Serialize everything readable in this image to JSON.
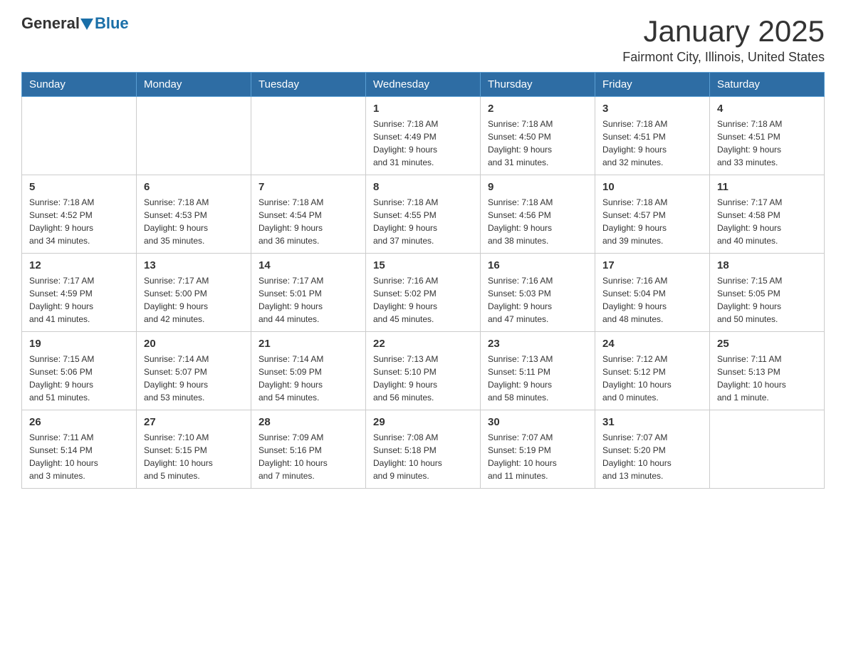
{
  "header": {
    "logo": {
      "general": "General",
      "blue": "Blue"
    },
    "title": "January 2025",
    "location": "Fairmont City, Illinois, United States"
  },
  "days_of_week": [
    "Sunday",
    "Monday",
    "Tuesday",
    "Wednesday",
    "Thursday",
    "Friday",
    "Saturday"
  ],
  "weeks": [
    {
      "cells": [
        {
          "day": "",
          "info": ""
        },
        {
          "day": "",
          "info": ""
        },
        {
          "day": "",
          "info": ""
        },
        {
          "day": "1",
          "info": "Sunrise: 7:18 AM\nSunset: 4:49 PM\nDaylight: 9 hours\nand 31 minutes."
        },
        {
          "day": "2",
          "info": "Sunrise: 7:18 AM\nSunset: 4:50 PM\nDaylight: 9 hours\nand 31 minutes."
        },
        {
          "day": "3",
          "info": "Sunrise: 7:18 AM\nSunset: 4:51 PM\nDaylight: 9 hours\nand 32 minutes."
        },
        {
          "day": "4",
          "info": "Sunrise: 7:18 AM\nSunset: 4:51 PM\nDaylight: 9 hours\nand 33 minutes."
        }
      ]
    },
    {
      "cells": [
        {
          "day": "5",
          "info": "Sunrise: 7:18 AM\nSunset: 4:52 PM\nDaylight: 9 hours\nand 34 minutes."
        },
        {
          "day": "6",
          "info": "Sunrise: 7:18 AM\nSunset: 4:53 PM\nDaylight: 9 hours\nand 35 minutes."
        },
        {
          "day": "7",
          "info": "Sunrise: 7:18 AM\nSunset: 4:54 PM\nDaylight: 9 hours\nand 36 minutes."
        },
        {
          "day": "8",
          "info": "Sunrise: 7:18 AM\nSunset: 4:55 PM\nDaylight: 9 hours\nand 37 minutes."
        },
        {
          "day": "9",
          "info": "Sunrise: 7:18 AM\nSunset: 4:56 PM\nDaylight: 9 hours\nand 38 minutes."
        },
        {
          "day": "10",
          "info": "Sunrise: 7:18 AM\nSunset: 4:57 PM\nDaylight: 9 hours\nand 39 minutes."
        },
        {
          "day": "11",
          "info": "Sunrise: 7:17 AM\nSunset: 4:58 PM\nDaylight: 9 hours\nand 40 minutes."
        }
      ]
    },
    {
      "cells": [
        {
          "day": "12",
          "info": "Sunrise: 7:17 AM\nSunset: 4:59 PM\nDaylight: 9 hours\nand 41 minutes."
        },
        {
          "day": "13",
          "info": "Sunrise: 7:17 AM\nSunset: 5:00 PM\nDaylight: 9 hours\nand 42 minutes."
        },
        {
          "day": "14",
          "info": "Sunrise: 7:17 AM\nSunset: 5:01 PM\nDaylight: 9 hours\nand 44 minutes."
        },
        {
          "day": "15",
          "info": "Sunrise: 7:16 AM\nSunset: 5:02 PM\nDaylight: 9 hours\nand 45 minutes."
        },
        {
          "day": "16",
          "info": "Sunrise: 7:16 AM\nSunset: 5:03 PM\nDaylight: 9 hours\nand 47 minutes."
        },
        {
          "day": "17",
          "info": "Sunrise: 7:16 AM\nSunset: 5:04 PM\nDaylight: 9 hours\nand 48 minutes."
        },
        {
          "day": "18",
          "info": "Sunrise: 7:15 AM\nSunset: 5:05 PM\nDaylight: 9 hours\nand 50 minutes."
        }
      ]
    },
    {
      "cells": [
        {
          "day": "19",
          "info": "Sunrise: 7:15 AM\nSunset: 5:06 PM\nDaylight: 9 hours\nand 51 minutes."
        },
        {
          "day": "20",
          "info": "Sunrise: 7:14 AM\nSunset: 5:07 PM\nDaylight: 9 hours\nand 53 minutes."
        },
        {
          "day": "21",
          "info": "Sunrise: 7:14 AM\nSunset: 5:09 PM\nDaylight: 9 hours\nand 54 minutes."
        },
        {
          "day": "22",
          "info": "Sunrise: 7:13 AM\nSunset: 5:10 PM\nDaylight: 9 hours\nand 56 minutes."
        },
        {
          "day": "23",
          "info": "Sunrise: 7:13 AM\nSunset: 5:11 PM\nDaylight: 9 hours\nand 58 minutes."
        },
        {
          "day": "24",
          "info": "Sunrise: 7:12 AM\nSunset: 5:12 PM\nDaylight: 10 hours\nand 0 minutes."
        },
        {
          "day": "25",
          "info": "Sunrise: 7:11 AM\nSunset: 5:13 PM\nDaylight: 10 hours\nand 1 minute."
        }
      ]
    },
    {
      "cells": [
        {
          "day": "26",
          "info": "Sunrise: 7:11 AM\nSunset: 5:14 PM\nDaylight: 10 hours\nand 3 minutes."
        },
        {
          "day": "27",
          "info": "Sunrise: 7:10 AM\nSunset: 5:15 PM\nDaylight: 10 hours\nand 5 minutes."
        },
        {
          "day": "28",
          "info": "Sunrise: 7:09 AM\nSunset: 5:16 PM\nDaylight: 10 hours\nand 7 minutes."
        },
        {
          "day": "29",
          "info": "Sunrise: 7:08 AM\nSunset: 5:18 PM\nDaylight: 10 hours\nand 9 minutes."
        },
        {
          "day": "30",
          "info": "Sunrise: 7:07 AM\nSunset: 5:19 PM\nDaylight: 10 hours\nand 11 minutes."
        },
        {
          "day": "31",
          "info": "Sunrise: 7:07 AM\nSunset: 5:20 PM\nDaylight: 10 hours\nand 13 minutes."
        },
        {
          "day": "",
          "info": ""
        }
      ]
    }
  ]
}
